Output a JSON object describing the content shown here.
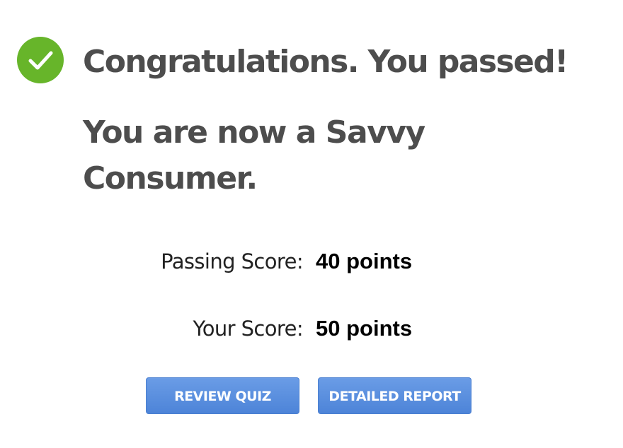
{
  "result": {
    "headline": "Congratulations. You passed!",
    "message": "You are now a Savvy Consumer.",
    "icon": "check-circle-icon",
    "icon_color": "#67b52a"
  },
  "scores": {
    "passing": {
      "label": "Passing Score:",
      "value": "40 points"
    },
    "yours": {
      "label": "Your Score:",
      "value": "50 points"
    }
  },
  "actions": {
    "review_quiz": "REVIEW QUIZ",
    "detailed_report": "DETAILED REPORT",
    "button_color": "#5b8fde"
  }
}
